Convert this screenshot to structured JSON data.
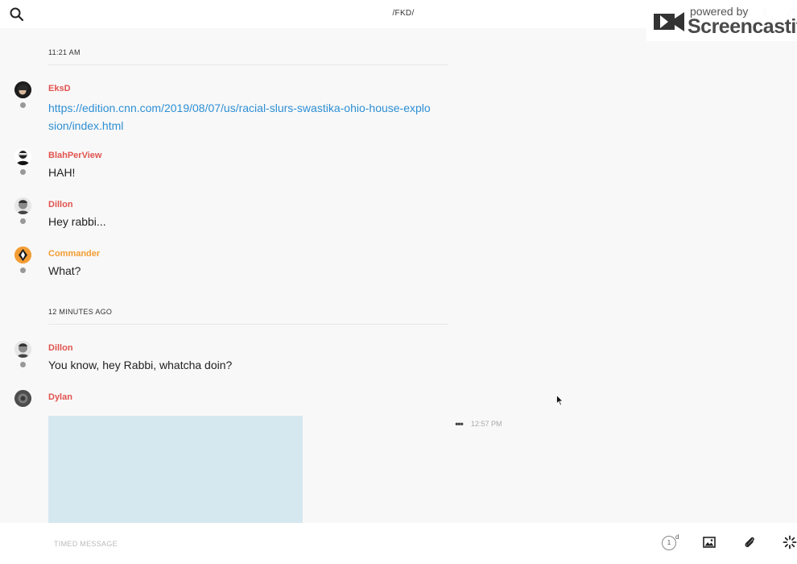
{
  "header": {
    "channel_title": "/FKD/"
  },
  "watermark": {
    "small_text": "powered by",
    "brand_text": "Screencastify"
  },
  "timeline": {
    "separator_1": "11:21 AM",
    "separator_2": "12 MINUTES AGO",
    "messages": [
      {
        "author": "EksD",
        "text": "https://edition.cnn.com/2019/08/07/us/racial-slurs-swastika-ohio-house-explosion/index.html"
      },
      {
        "author": "BlahPerView",
        "text": "HAH!"
      },
      {
        "author": "Dillon",
        "text": "Hey rabbi..."
      },
      {
        "author": "Commander",
        "text": "What?"
      },
      {
        "author": "Dillon",
        "text": "You know, hey Rabbi, whatcha doin?"
      },
      {
        "author": "Dylan",
        "text": "",
        "time": "12:57 PM"
      }
    ]
  },
  "composer": {
    "placeholder": "TIMED MESSAGE",
    "timer_value": "1",
    "timer_unit": "d"
  },
  "colors": {
    "author_red": "#e0534f",
    "author_orange": "#f39c34",
    "link_blue": "#2c8fd4",
    "image_placeholder": "#d6e8ef"
  },
  "icons": [
    "search-icon",
    "phone-icon",
    "info-icon",
    "screencastify-logo",
    "more-dots-icon",
    "timer-icon",
    "image-icon",
    "paperclip-icon",
    "gif-spinner-icon",
    "cursor-icon"
  ]
}
